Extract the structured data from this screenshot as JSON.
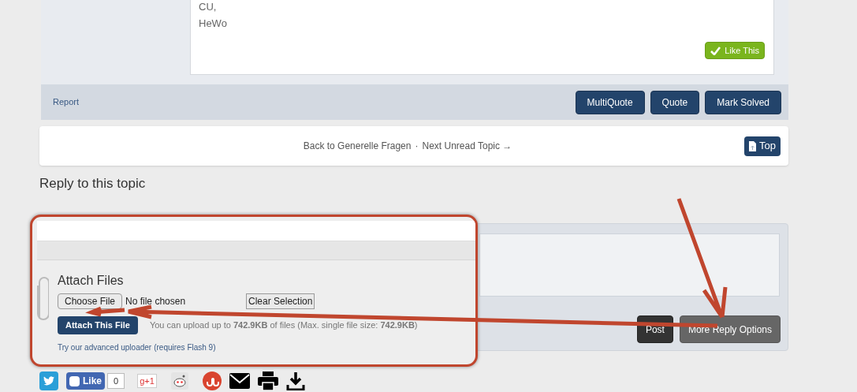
{
  "post": {
    "lines": [
      "CU,",
      "HeWo"
    ],
    "like_button": "Like This",
    "report_link": "Report",
    "actions": [
      "MultiQuote",
      "Quote",
      "Mark Solved"
    ]
  },
  "topic_nav": {
    "back_link": "Back to Generelle Fragen",
    "separator": "·",
    "next_link": "Next Unread Topic →",
    "top_button": "Top"
  },
  "reply_heading": "Reply to this topic",
  "reply_form": {
    "buttons": [
      {
        "label": "Post",
        "kind": "primary"
      },
      {
        "label": "More Reply Options",
        "kind": "secondary"
      }
    ]
  },
  "attach": {
    "title": "Attach Files",
    "choose_button": "Choose File",
    "file_status": "No file chosen",
    "clear_button": "Clear Selection",
    "attach_button": "Attach This File",
    "upload_info": "You can upload up to **742.9KB** of files (Max. single file size: **742.9KB**)",
    "uploader_link": "Try our advanced uploader",
    "uploader_note": "(requires Flash 9)"
  },
  "share": {
    "fb_like": "Like",
    "fb_count": "0",
    "gplus": "g+1"
  }
}
